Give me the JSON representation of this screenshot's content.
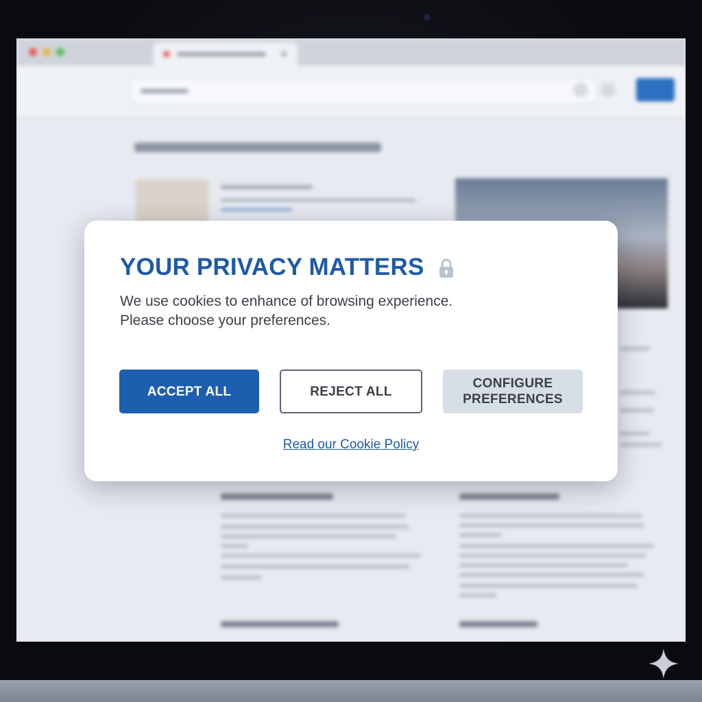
{
  "colors": {
    "accent": "#1e5aa6",
    "accept_bg": "#1e5eae",
    "configure_bg": "#d8dee6",
    "modal_bg": "#ffffff"
  },
  "modal": {
    "title": "YOUR PRIVACY MATTERS",
    "title_icon": "lock-icon",
    "message_line1": "We use cookies to enhance of browsing experience.",
    "message_line2": "Please choose your preferences.",
    "accept_label": "ACCEPT ALL",
    "reject_label": "REJECT ALL",
    "configure_label_line1": "CONFIGURE",
    "configure_label_line2": "PREFERENCES",
    "policy_link": "Read our Cookie Policy"
  },
  "icons": {
    "browser_close": "close-icon",
    "corner": "sparkle-icon"
  }
}
